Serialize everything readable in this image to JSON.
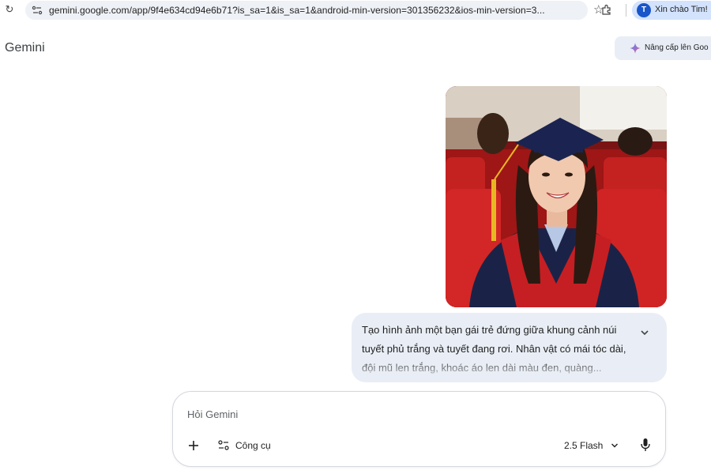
{
  "browser": {
    "url": "gemini.google.com/app/9f4e634cd94e6b71?is_sa=1&is_sa=1&android-min-version=301356232&ios-min-version=3...",
    "profile_initial": "T",
    "profile_greeting": "Xin chào Tim!",
    "icons": [
      "reload-icon",
      "site-info-icon",
      "star-icon",
      "extensions-icon"
    ]
  },
  "header": {
    "title": "Gemini",
    "upgrade_label": "Nâng cấp lên Goo"
  },
  "conversation": {
    "user_image": "graduation-portrait",
    "prompt_text": "Tạo hình ảnh một bạn gái trẻ đứng giữa khung cảnh núi tuyết phủ trắng và tuyết đang rơi. Nhân vật có mái tóc dài, đội mũ len trắng, khoác áo len dài màu đen, quàng..."
  },
  "composer": {
    "placeholder": "Hỏi Gemini",
    "value": "",
    "tools_label": "Công cụ",
    "model_label": "2.5 Flash"
  },
  "colors": {
    "bubble": "#e9eef6",
    "profile_chip": "#d3e3fd",
    "avatar": "#1a56c9"
  }
}
